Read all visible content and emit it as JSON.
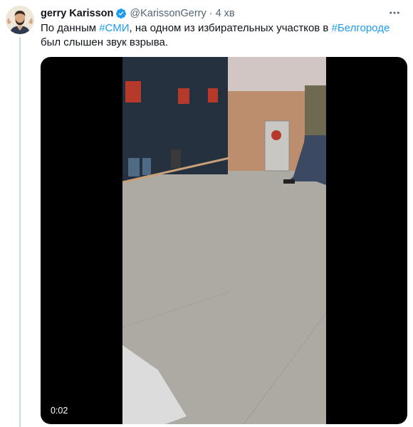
{
  "author": {
    "name": "gerry Karisson",
    "handle": "@KarissonGerry",
    "separator": "·",
    "time": "4 хв",
    "verified_icon": "verified-badge-icon",
    "avatar_icon": "profile-avatar"
  },
  "tweet": {
    "text_part1": "По данным ",
    "hashtag1": "#СМИ",
    "text_part2": ", на одном из избирательных участков в ",
    "hashtag2": "#Белгороде",
    "text_part3": " был слышен звук взрыва."
  },
  "media": {
    "duration": "0:02"
  },
  "colors": {
    "accent": "#1d9bf0",
    "text": "#0f1419",
    "secondary": "#536471",
    "thread_line": "#cfd9de"
  }
}
